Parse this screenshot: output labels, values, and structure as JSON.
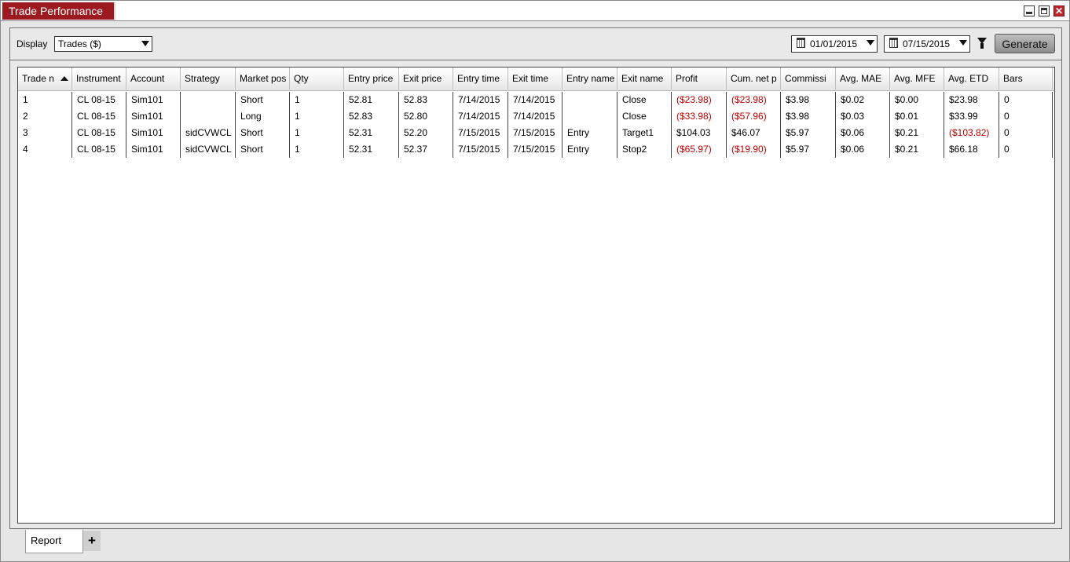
{
  "window": {
    "title": "Trade Performance",
    "close_glyph": "✕"
  },
  "toolbar": {
    "display_label": "Display",
    "display_value": "Trades ($)",
    "date_from": "01/01/2015",
    "date_to": "07/15/2015",
    "generate_label": "Generate"
  },
  "grid": {
    "columns": [
      "Trade n",
      "Instrument",
      "Account",
      "Strategy",
      "Market pos",
      "Qty",
      "Entry price",
      "Exit price",
      "Entry time",
      "Exit time",
      "Entry name",
      "Exit name",
      "Profit",
      "Cum. net p",
      "Commissi",
      "Avg. MAE",
      "Avg. MFE",
      "Avg. ETD",
      "Bars"
    ],
    "sort": {
      "column": "Trade n",
      "direction": "ascending"
    },
    "rows": [
      [
        "1",
        "CL 08-15",
        "Sim101",
        "",
        "Short",
        "1",
        "52.81",
        "52.83",
        "7/14/2015",
        "7/14/2015",
        "",
        "Close",
        "($23.98)",
        "($23.98)",
        "$3.98",
        "$0.02",
        "$0.00",
        "$23.98",
        "0"
      ],
      [
        "2",
        "CL 08-15",
        "Sim101",
        "",
        "Long",
        "1",
        "52.83",
        "52.80",
        "7/14/2015",
        "7/14/2015",
        "",
        "Close",
        "($33.98)",
        "($57.96)",
        "$3.98",
        "$0.03",
        "$0.01",
        "$33.99",
        "0"
      ],
      [
        "3",
        "CL 08-15",
        "Sim101",
        "sidCVWCL",
        "Short",
        "1",
        "52.31",
        "52.20",
        "7/15/2015",
        "7/15/2015",
        "Entry",
        "Target1",
        "$104.03",
        "$46.07",
        "$5.97",
        "$0.06",
        "$0.21",
        "($103.82)",
        "0"
      ],
      [
        "4",
        "CL 08-15",
        "Sim101",
        "sidCVWCL",
        "Short",
        "1",
        "52.31",
        "52.37",
        "7/15/2015",
        "7/15/2015",
        "Entry",
        "Stop2",
        "($65.97)",
        "($19.90)",
        "$5.97",
        "$0.06",
        "$0.21",
        "$66.18",
        "0"
      ]
    ]
  },
  "tabs": {
    "report_label": "Report",
    "add_label": "+"
  },
  "colors": {
    "title_accent": "#9c1a1f",
    "negative": "#c00000"
  }
}
